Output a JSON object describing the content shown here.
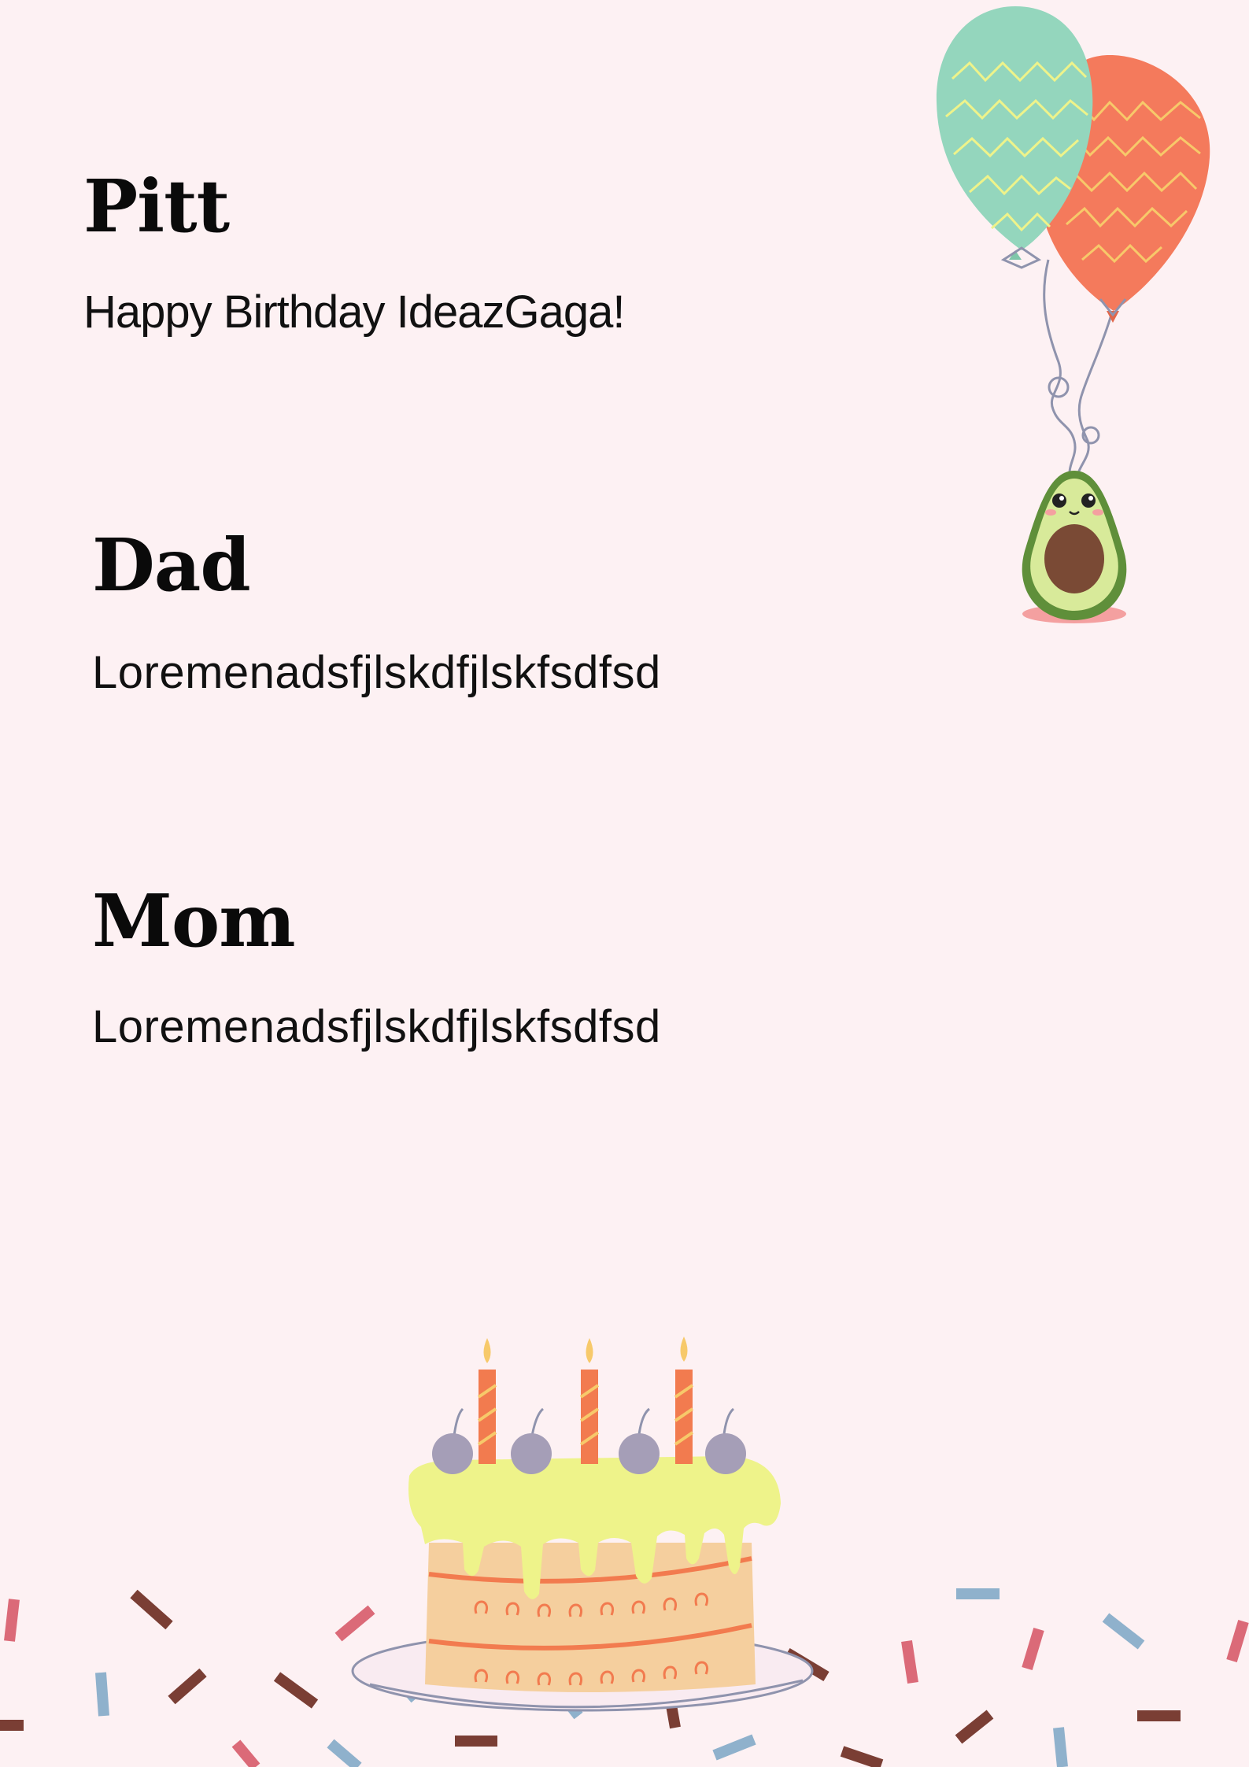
{
  "messages": [
    {
      "name": "Pitt",
      "text": "Happy Birthday IdeazGaga!"
    },
    {
      "name": "Dad",
      "text": "Loremenadsfjlskdfjlskfsdfsd"
    },
    {
      "name": "Mom",
      "text": "Loremenadsfjlskdfjlskfsdfsd"
    }
  ],
  "illustrations": {
    "balloons": "balloons-with-avocado-icon",
    "cake": "birthday-cake-icon",
    "confetti": "confetti-sprinkles-icon"
  },
  "colors": {
    "background": "#fdf1f3",
    "balloon_green": "#94d6bd",
    "balloon_orange": "#f47a5c",
    "avocado": "#8cc05a",
    "icing": "#eef38a",
    "cake": "#f5cf9e",
    "candle": "#f27b4f"
  }
}
